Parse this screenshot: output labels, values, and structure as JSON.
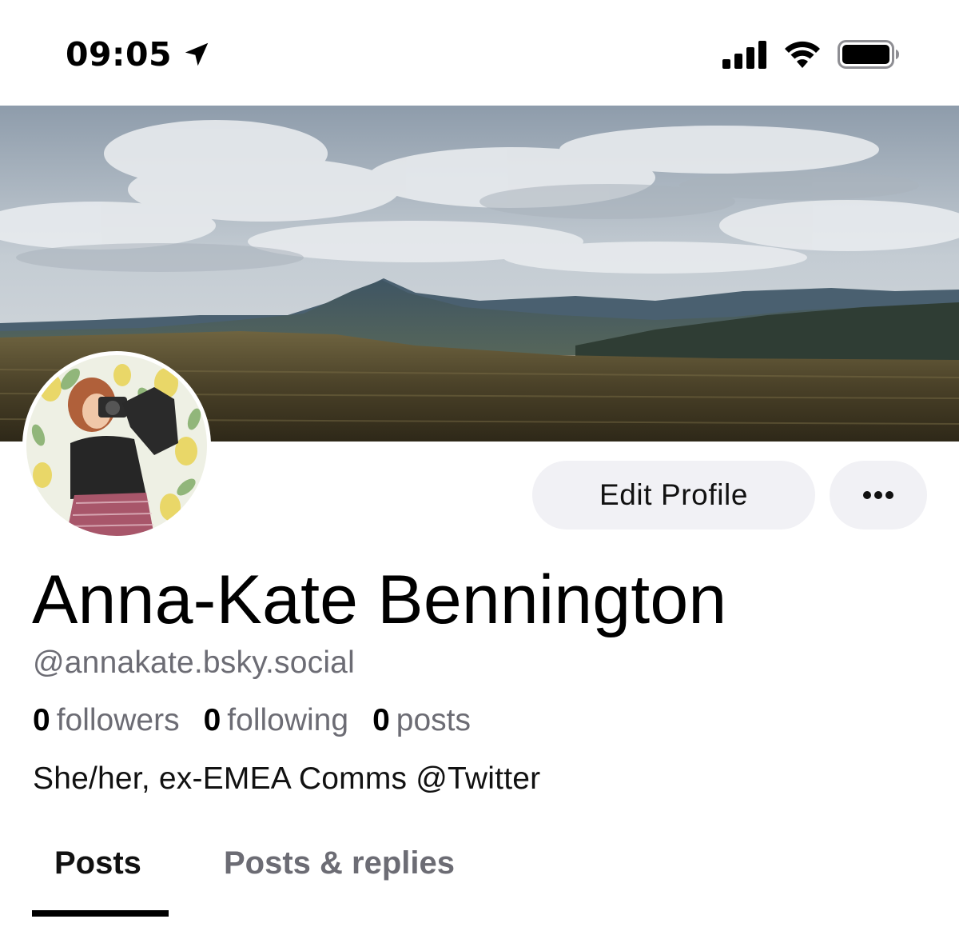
{
  "status_bar": {
    "time": "09:05"
  },
  "profile": {
    "display_name": "Anna-Kate Bennington",
    "handle": "@annakate.bsky.social",
    "bio": "She/her, ex-EMEA Comms @Twitter",
    "stats": {
      "followers_count": "0",
      "followers_label": "followers",
      "following_count": "0",
      "following_label": "following",
      "posts_count": "0",
      "posts_label": "posts"
    }
  },
  "actions": {
    "edit_profile_label": "Edit Profile",
    "more_icon": "ellipsis-icon"
  },
  "tabs": [
    {
      "label": "Posts",
      "active": true
    },
    {
      "label": "Posts & replies",
      "active": false
    }
  ],
  "colors": {
    "muted_text": "#6c6c74",
    "button_bg": "#f1f1f5",
    "active_tab_indicator": "#000000"
  }
}
